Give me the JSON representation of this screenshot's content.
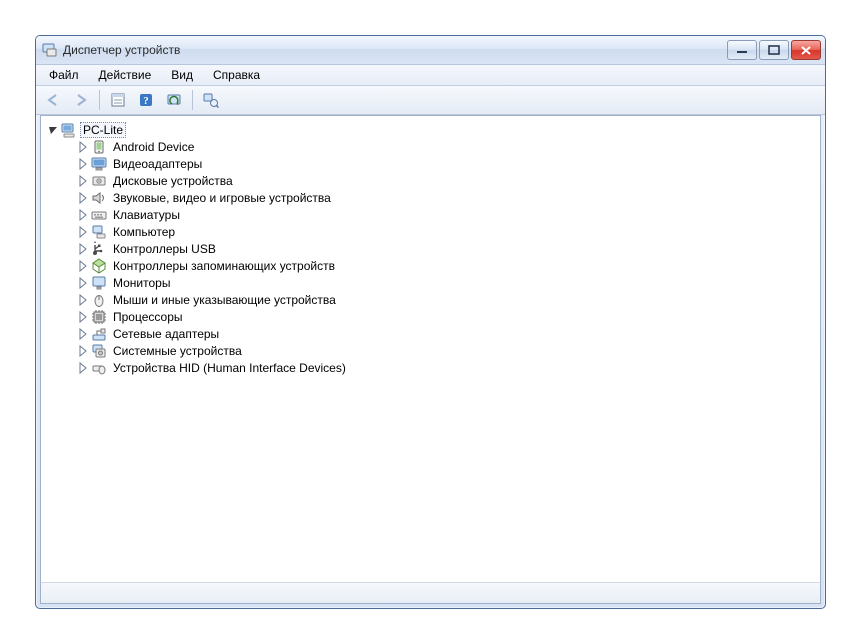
{
  "window": {
    "title": "Диспетчер устройств"
  },
  "menu": {
    "file": "Файл",
    "action": "Действие",
    "view": "Вид",
    "help": "Справка"
  },
  "tree": {
    "root": "PC-Lite",
    "items": [
      {
        "icon": "android",
        "label": "Android Device"
      },
      {
        "icon": "display",
        "label": "Видеоадаптеры"
      },
      {
        "icon": "disk",
        "label": "Дисковые устройства"
      },
      {
        "icon": "sound",
        "label": "Звуковые, видео и игровые устройства"
      },
      {
        "icon": "keyboard",
        "label": "Клавиатуры"
      },
      {
        "icon": "computer",
        "label": "Компьютер"
      },
      {
        "icon": "usb",
        "label": "Контроллеры USB"
      },
      {
        "icon": "storage",
        "label": "Контроллеры запоминающих устройств"
      },
      {
        "icon": "monitor",
        "label": "Мониторы"
      },
      {
        "icon": "mouse",
        "label": "Мыши и иные указывающие устройства"
      },
      {
        "icon": "cpu",
        "label": "Процессоры"
      },
      {
        "icon": "network",
        "label": "Сетевые адаптеры"
      },
      {
        "icon": "system",
        "label": "Системные устройства"
      },
      {
        "icon": "hid",
        "label": "Устройства HID (Human Interface Devices)"
      }
    ]
  }
}
